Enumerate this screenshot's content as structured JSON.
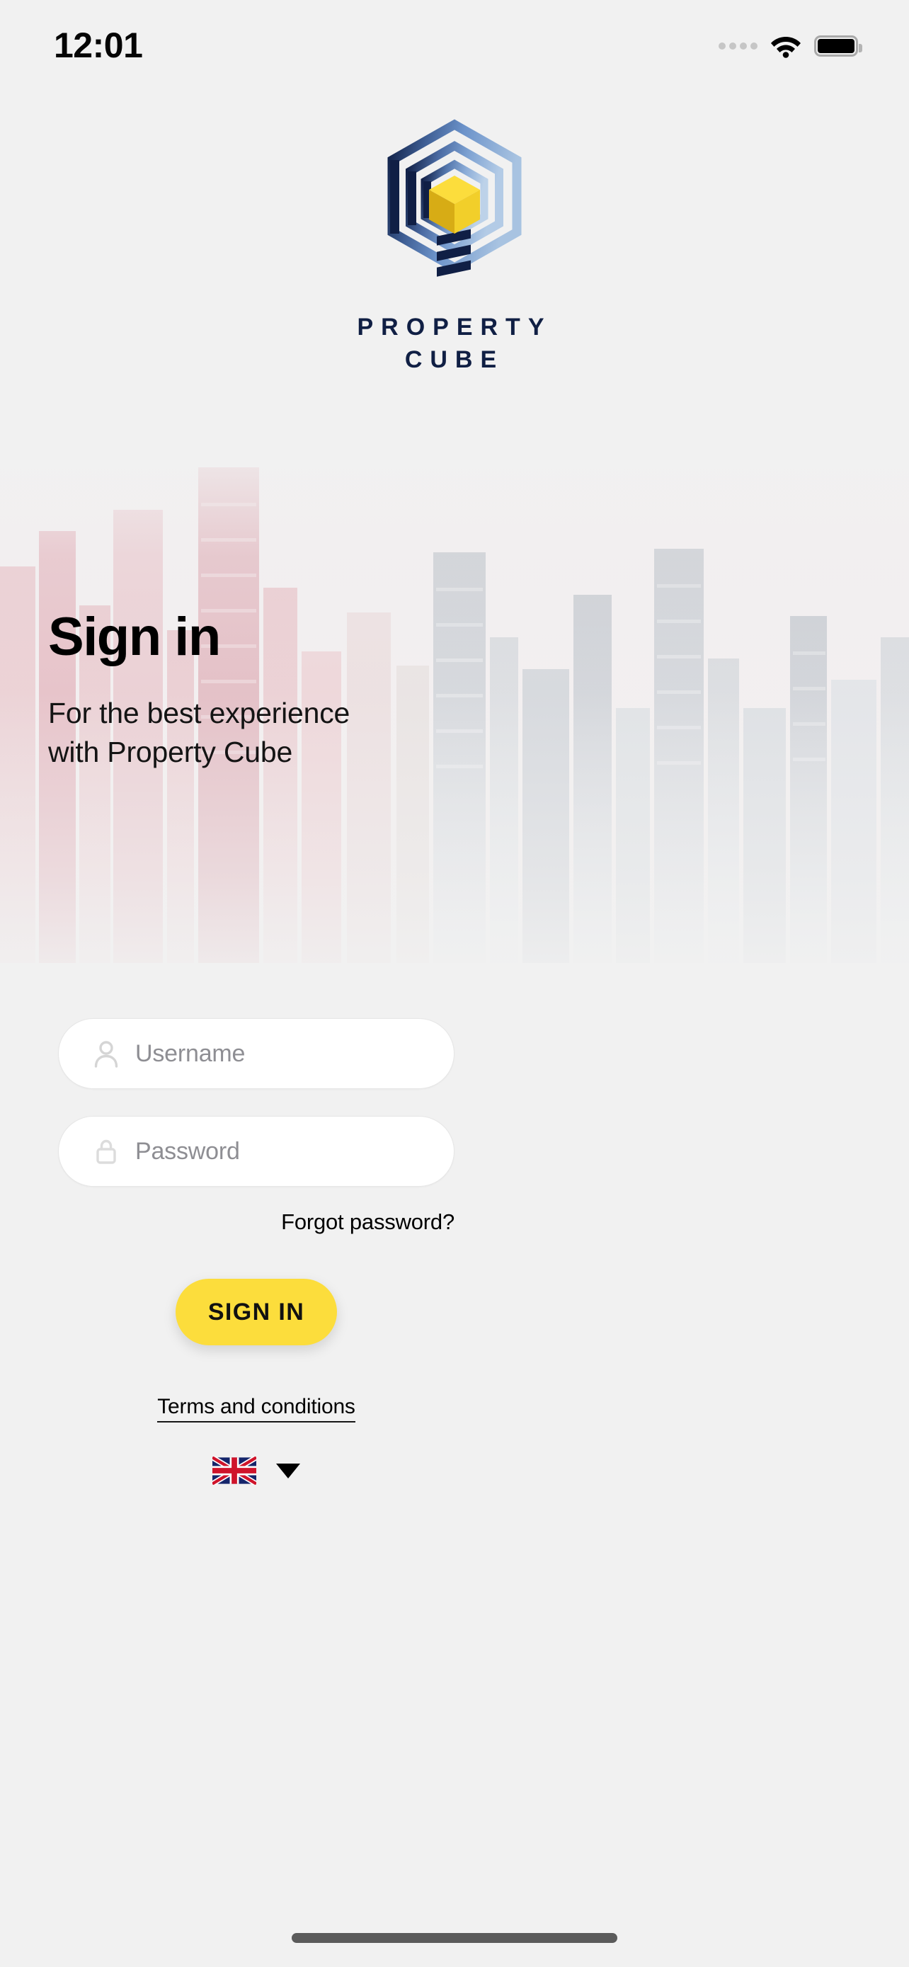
{
  "status_bar": {
    "time": "12:01",
    "signal_icon": "signal-dots-icon",
    "wifi_icon": "wifi-icon",
    "battery_icon": "battery-full-icon"
  },
  "logo": {
    "mark_icon": "property-cube-hexagon-logo-icon",
    "brand_line1": "PROPERTY",
    "brand_line2": "CUBE",
    "colors": {
      "navy": "#101f44",
      "blue_mid": "#6a92c8",
      "blue_light": "#a9c4e2",
      "cube_yellow": "#fcdd3c",
      "cube_yellow_dark": "#d9b31a"
    }
  },
  "headings": {
    "title": "Sign in",
    "subtitle_line1": "For the best experience",
    "subtitle_line2": "with Property Cube"
  },
  "form": {
    "username": {
      "placeholder": "Username",
      "value": "",
      "icon": "person-icon"
    },
    "password": {
      "placeholder": "Password",
      "value": "",
      "icon": "lock-icon"
    },
    "forgot_password_label": "Forgot password?",
    "submit_label": "SIGN IN",
    "submit_color": "#fcdd3c"
  },
  "footer": {
    "terms_label": "Terms and conditions",
    "language_flag_icon": "uk-flag-icon",
    "language_dropdown_icon": "caret-down-icon"
  },
  "system": {
    "home_indicator": "home-indicator"
  }
}
